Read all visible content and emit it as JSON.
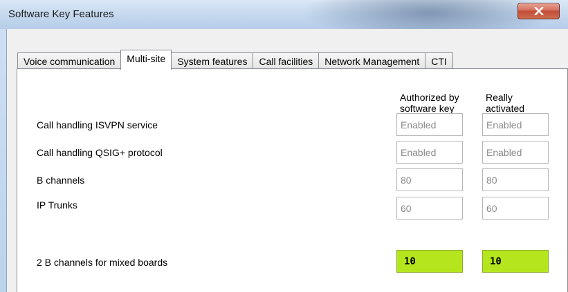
{
  "window": {
    "title": "Software Key Features"
  },
  "tabs": [
    {
      "label": "Voice communication",
      "active": false
    },
    {
      "label": "Multi-site",
      "active": true
    },
    {
      "label": "System features",
      "active": false
    },
    {
      "label": "Call facilities",
      "active": false
    },
    {
      "label": "Network Management",
      "active": false
    },
    {
      "label": "CTI",
      "active": false
    }
  ],
  "columns": {
    "authorized": [
      "Authorized by",
      "software key"
    ],
    "activated": [
      "Really",
      "activated"
    ]
  },
  "rows": [
    {
      "label": "Call handling ISVPN service",
      "authorized": "Enabled",
      "activated": "Enabled"
    },
    {
      "label": "Call handling QSIG+ protocol",
      "authorized": "Enabled",
      "activated": "Enabled"
    },
    {
      "label": "B channels",
      "authorized": "80",
      "activated": "80"
    },
    {
      "label": "IP Trunks",
      "authorized": "60",
      "activated": "60"
    },
    {
      "label": "2 B channels for mixed boards",
      "authorized": "10",
      "activated": "10",
      "highlight": "#b5e61d"
    }
  ]
}
